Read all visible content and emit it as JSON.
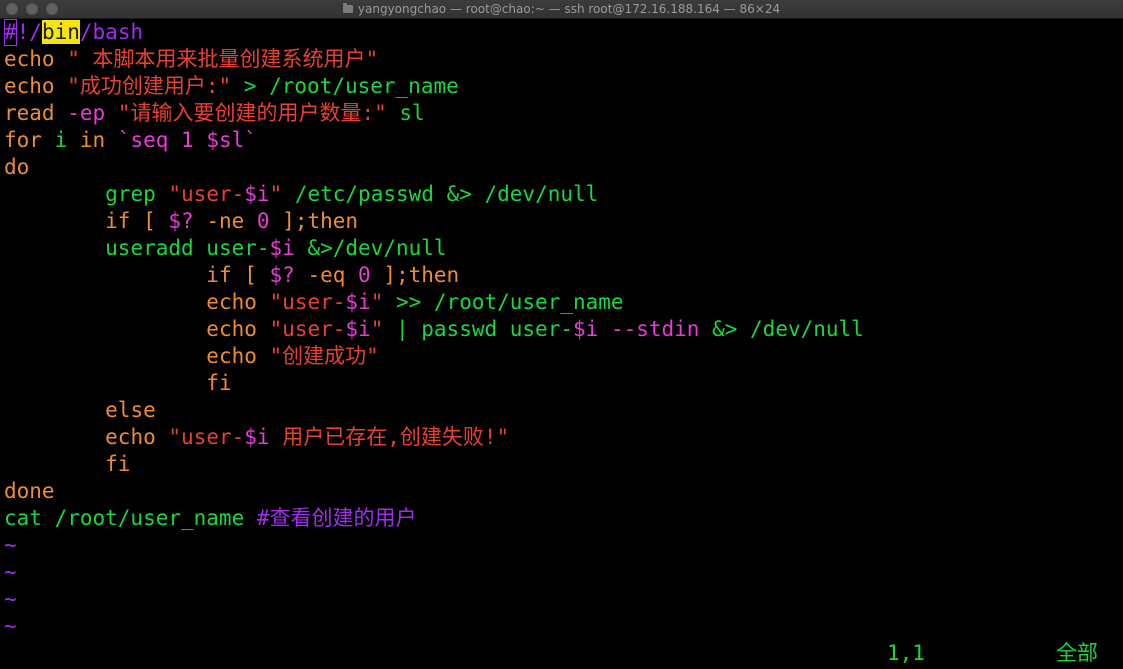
{
  "window": {
    "title": "yangyongchao — root@chao:~ — ssh root@172.16.188.164 — 86×24"
  },
  "colors": {
    "background": "#000000",
    "keyword_orange": "#f08c2e",
    "string_red": "#e8412f",
    "variable_magenta": "#ea3ad8",
    "command_green": "#19d83a",
    "comment_purple": "#a12bf2",
    "search_highlight": "#f5e50b"
  },
  "editor": {
    "lines": [
      [
        {
          "t": "#",
          "c": "#a12bf2",
          "cursor": true
        },
        {
          "t": "!/",
          "c": "#a12bf2"
        },
        {
          "t": "bin",
          "c": "#222222",
          "hl": true
        },
        {
          "t": "/bash",
          "c": "#a12bf2"
        }
      ],
      [
        {
          "t": "echo",
          "c": "#f08c2e"
        },
        {
          "t": " \" 本脚本用来批量创建系统用户\"",
          "c": "#e8412f"
        }
      ],
      [
        {
          "t": "echo",
          "c": "#f08c2e"
        },
        {
          "t": " ",
          "c": "#ffffff"
        },
        {
          "t": "\"成功创建用户:\"",
          "c": "#e8412f"
        },
        {
          "t": " > /root/user_name",
          "c": "#19d83a"
        }
      ],
      [
        {
          "t": "read",
          "c": "#f08c2e"
        },
        {
          "t": " ",
          "c": "#ffffff"
        },
        {
          "t": "-ep",
          "c": "#ea3ad8"
        },
        {
          "t": " ",
          "c": "#ffffff"
        },
        {
          "t": "\"请输入要创建的用户数量:\"",
          "c": "#e8412f"
        },
        {
          "t": " sl",
          "c": "#19d83a"
        }
      ],
      [
        {
          "t": "for",
          "c": "#f08c2e"
        },
        {
          "t": " i ",
          "c": "#19d83a"
        },
        {
          "t": "in",
          "c": "#f08c2e"
        },
        {
          "t": " ",
          "c": "#ffffff"
        },
        {
          "t": "`seq 1 $sl`",
          "c": "#ea3ad8"
        }
      ],
      [
        {
          "t": "do",
          "c": "#f08c2e"
        }
      ],
      [
        {
          "t": "        ",
          "c": "#ffffff"
        },
        {
          "t": "grep",
          "c": "#19d83a"
        },
        {
          "t": " ",
          "c": "#ffffff"
        },
        {
          "t": "\"user-",
          "c": "#e8412f"
        },
        {
          "t": "$i",
          "c": "#ea3ad8"
        },
        {
          "t": "\"",
          "c": "#e8412f"
        },
        {
          "t": " /etc/passwd &> /dev/null",
          "c": "#19d83a"
        }
      ],
      [
        {
          "t": "        ",
          "c": "#ffffff"
        },
        {
          "t": "if [ ",
          "c": "#f08c2e"
        },
        {
          "t": "$?",
          "c": "#ea3ad8"
        },
        {
          "t": " -ne ",
          "c": "#f08c2e"
        },
        {
          "t": "0",
          "c": "#ea3ad8"
        },
        {
          "t": " ];then",
          "c": "#f08c2e"
        }
      ],
      [
        {
          "t": "        ",
          "c": "#ffffff"
        },
        {
          "t": "useradd user-",
          "c": "#19d83a"
        },
        {
          "t": "$i",
          "c": "#ea3ad8"
        },
        {
          "t": " &>/dev/null",
          "c": "#19d83a"
        }
      ],
      [
        {
          "t": "                ",
          "c": "#ffffff"
        },
        {
          "t": "if [ ",
          "c": "#f08c2e"
        },
        {
          "t": "$?",
          "c": "#ea3ad8"
        },
        {
          "t": " -eq ",
          "c": "#f08c2e"
        },
        {
          "t": "0",
          "c": "#ea3ad8"
        },
        {
          "t": " ];then",
          "c": "#f08c2e"
        }
      ],
      [
        {
          "t": "                ",
          "c": "#ffffff"
        },
        {
          "t": "echo",
          "c": "#f08c2e"
        },
        {
          "t": " ",
          "c": "#ffffff"
        },
        {
          "t": "\"user-",
          "c": "#e8412f"
        },
        {
          "t": "$i",
          "c": "#ea3ad8"
        },
        {
          "t": "\"",
          "c": "#e8412f"
        },
        {
          "t": " >> /root/user_name",
          "c": "#19d83a"
        }
      ],
      [
        {
          "t": "                ",
          "c": "#ffffff"
        },
        {
          "t": "echo",
          "c": "#f08c2e"
        },
        {
          "t": " ",
          "c": "#ffffff"
        },
        {
          "t": "\"user-",
          "c": "#e8412f"
        },
        {
          "t": "$i",
          "c": "#ea3ad8"
        },
        {
          "t": "\"",
          "c": "#e8412f"
        },
        {
          "t": " | passwd user-",
          "c": "#19d83a"
        },
        {
          "t": "$i",
          "c": "#ea3ad8"
        },
        {
          "t": " ",
          "c": "#ffffff"
        },
        {
          "t": "--stdin",
          "c": "#ea3ad8"
        },
        {
          "t": " &> /dev/null",
          "c": "#19d83a"
        }
      ],
      [
        {
          "t": "                ",
          "c": "#ffffff"
        },
        {
          "t": "echo",
          "c": "#f08c2e"
        },
        {
          "t": " ",
          "c": "#ffffff"
        },
        {
          "t": "\"创建成功\"",
          "c": "#e8412f"
        }
      ],
      [
        {
          "t": "                ",
          "c": "#ffffff"
        },
        {
          "t": "fi",
          "c": "#f08c2e"
        }
      ],
      [
        {
          "t": "        ",
          "c": "#ffffff"
        },
        {
          "t": "else",
          "c": "#f08c2e"
        }
      ],
      [
        {
          "t": "        ",
          "c": "#ffffff"
        },
        {
          "t": "echo",
          "c": "#f08c2e"
        },
        {
          "t": " ",
          "c": "#ffffff"
        },
        {
          "t": "\"user-",
          "c": "#e8412f"
        },
        {
          "t": "$i",
          "c": "#ea3ad8"
        },
        {
          "t": " 用户已存在,创建失败!\"",
          "c": "#e8412f"
        }
      ],
      [
        {
          "t": "        ",
          "c": "#ffffff"
        },
        {
          "t": "fi",
          "c": "#f08c2e"
        }
      ],
      [
        {
          "t": "done",
          "c": "#f08c2e"
        }
      ],
      [
        {
          "t": "cat /root/user_name ",
          "c": "#19d83a"
        },
        {
          "t": "#查看创建的用户",
          "c": "#a12bf2"
        }
      ]
    ],
    "tildes": [
      "~",
      "~",
      "~",
      "~"
    ]
  },
  "status": {
    "position": "1,1",
    "view": "全部"
  }
}
